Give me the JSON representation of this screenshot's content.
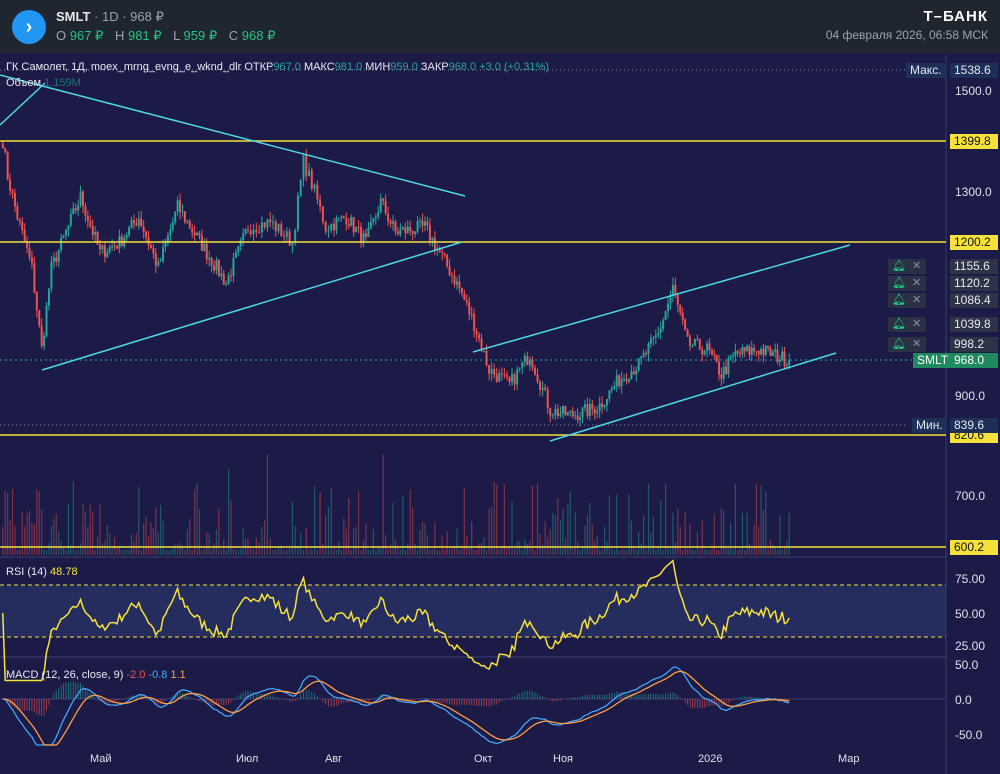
{
  "header": {
    "symbol": "SMLT",
    "interval": "1D",
    "price": "968 ₽",
    "ohlc": [
      {
        "k": "O",
        "v": "967 ₽"
      },
      {
        "k": "H",
        "v": "981 ₽"
      },
      {
        "k": "L",
        "v": "959 ₽"
      },
      {
        "k": "C",
        "v": "968 ₽"
      }
    ],
    "brand": "Т–БАНК",
    "datetime": "04 февраля 2026, 06:58 МСК"
  },
  "legend": {
    "title": "ГК Самолет, 1Д, moex_mrng_evng_e_wknd_dlr",
    "open_label": "ОТКР",
    "open": "967.0",
    "high_label": "МАКС",
    "high": "981.0",
    "low_label": "МИН",
    "low": "959.0",
    "close_label": "ЗАКР",
    "close": "968.0",
    "change": "+3.0 (+0.31%)",
    "volume_label": "Объем",
    "volume": "1.159M"
  },
  "price_axis": {
    "ticks": [
      "1500.0",
      "1300.0",
      "900.0",
      "700.0"
    ],
    "max_label": "Макс.",
    "max": "1538.6",
    "min_label": "Мин.",
    "min": "839.6",
    "levels": [
      "1399.8",
      "1200.2",
      "820.6",
      "600.2"
    ],
    "alerts": [
      "1155.6",
      "1120.2",
      "1086.4",
      "1039.8",
      "998.2"
    ],
    "last_symbol": "SMLT",
    "last": "968.0"
  },
  "rsi": {
    "label": "RSI (14)",
    "value": "48.78",
    "ticks": [
      "75.00",
      "50.00",
      "25.00"
    ]
  },
  "macd": {
    "label": "MACD (12, 26, close, 9)",
    "hist": "-2.0",
    "macd": "-0.8",
    "signal": "1.1",
    "ticks": [
      "50.0",
      "0.0",
      "-50.0"
    ]
  },
  "time_axis": [
    "Май",
    "Июл",
    "Авг",
    "Окт",
    "Ноя",
    "2026",
    "Мар"
  ],
  "colors": {
    "up": "#26a69a",
    "down": "#ef5350",
    "level": "#f5e13b",
    "trend": "#4dd8e8",
    "rsi": "#f5e13b",
    "macd": "#42a5f5",
    "signal": "#ff9f43"
  },
  "chart_data": {
    "type": "candlestick",
    "approx_close_path": [
      [
        "2025-03-22",
        1400
      ],
      [
        "2025-03-24",
        1330
      ],
      [
        "2025-03-28",
        1250
      ],
      [
        "2025-04-03",
        1150
      ],
      [
        "2025-04-07",
        990
      ],
      [
        "2025-04-11",
        1150
      ],
      [
        "2025-04-17",
        1220
      ],
      [
        "2025-04-23",
        1290
      ],
      [
        "2025-05-01",
        1180
      ],
      [
        "2025-05-09",
        1200
      ],
      [
        "2025-05-17",
        1250
      ],
      [
        "2025-05-25",
        1150
      ],
      [
        "2025-06-02",
        1270
      ],
      [
        "2025-06-10",
        1210
      ],
      [
        "2025-06-22",
        1120
      ],
      [
        "2025-07-01",
        1230
      ],
      [
        "2025-07-09",
        1240
      ],
      [
        "2025-07-17",
        1200
      ],
      [
        "2025-07-21",
        1360
      ],
      [
        "2025-07-25",
        1300
      ],
      [
        "2025-07-29",
        1230
      ],
      [
        "2025-08-06",
        1250
      ],
      [
        "2025-08-14",
        1200
      ],
      [
        "2025-08-20",
        1280
      ],
      [
        "2025-08-26",
        1220
      ],
      [
        "2025-09-07",
        1230
      ],
      [
        "2025-09-13",
        1180
      ],
      [
        "2025-09-21",
        1110
      ],
      [
        "2025-09-27",
        1040
      ],
      [
        "2025-10-03",
        950
      ],
      [
        "2025-10-11",
        920
      ],
      [
        "2025-10-19",
        980
      ],
      [
        "2025-10-27",
        870
      ],
      [
        "2025-11-04",
        860
      ],
      [
        "2025-11-12",
        870
      ],
      [
        "2025-11-16",
        880
      ],
      [
        "2025-11-24",
        930
      ],
      [
        "2025-12-02",
        960
      ],
      [
        "2025-12-10",
        1020
      ],
      [
        "2025-12-16",
        1110
      ],
      [
        "2025-12-22",
        1000
      ],
      [
        "2025-12-30",
        990
      ],
      [
        "2026-01-05",
        940
      ],
      [
        "2026-01-11",
        980
      ],
      [
        "2026-01-21",
        990
      ],
      [
        "2026-02-03",
        968
      ]
    ],
    "ylim": [
      580,
      1545
    ]
  }
}
